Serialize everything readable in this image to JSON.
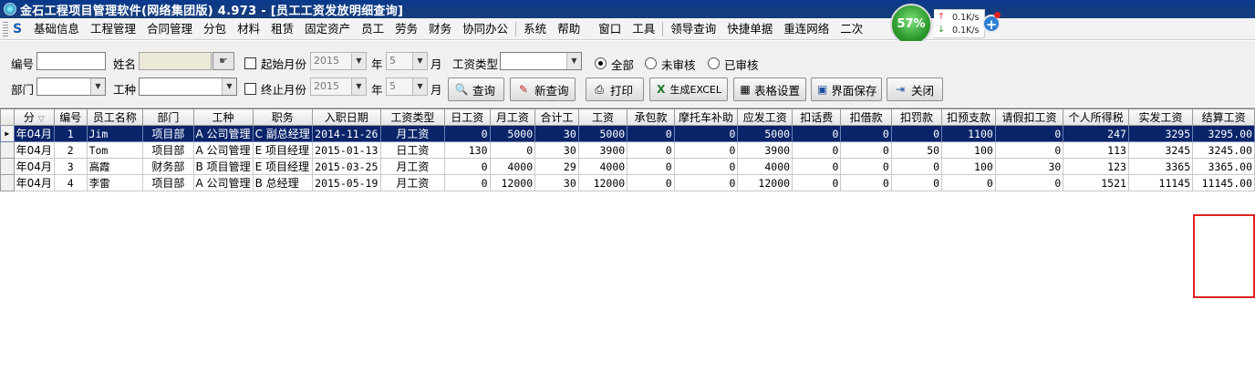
{
  "window": {
    "title": "金石工程项目管理软件(网络集团版) 4.973 - [员工工资发放明细查询]"
  },
  "menu": {
    "items": [
      "基础信息",
      "工程管理",
      "合同管理",
      "分包",
      "材料",
      "租赁",
      "固定资产",
      "员工",
      "劳务",
      "财务",
      "协同办公",
      "系统",
      "帮助",
      "窗口",
      "工具",
      "领导查询",
      "快捷单据",
      "重连网络",
      "二次"
    ]
  },
  "net_widget": {
    "percent": "57%",
    "up": "0.1K/s",
    "down": "0.1K/s",
    "up_arrow": "↑",
    "down_arrow": "↓",
    "plus": "+"
  },
  "filters": {
    "code_label": "编号",
    "code_value": "",
    "name_label": "姓名",
    "name_value": "",
    "start_month_label": "起始月份",
    "start_year": "2015",
    "start_month": "5",
    "year_label": "年",
    "month_label": "月",
    "salary_type_label": "工资类型",
    "salary_type_value": "",
    "radio_all": "全部",
    "radio_unaudited": "未审核",
    "radio_audited": "已审核",
    "dept_label": "部门",
    "dept_value": "",
    "worktype_label": "工种",
    "worktype_value": "",
    "end_month_label": "终止月份",
    "end_year": "2015",
    "end_month": "5"
  },
  "buttons": {
    "query": "查询",
    "new_query": "新查询",
    "print": "打印",
    "export_excel": "生成EXCEL",
    "table_settings": "表格设置",
    "save_layout": "界面保存",
    "close": "关闭"
  },
  "grid": {
    "columns": [
      "分",
      "编号",
      "员工名称",
      "部门",
      "工种",
      "职务",
      "入职日期",
      "工资类型",
      "日工资",
      "月工资",
      "合计工",
      "工资",
      "承包款",
      "摩托车补助",
      "应发工资",
      "扣话费",
      "扣借款",
      "扣罚款",
      "扣预支款",
      "请假扣工资",
      "个人所得税",
      "实发工资",
      "结算工资"
    ],
    "rows": [
      [
        "年04月",
        "1",
        "Jim",
        "项目部",
        "A 公司管理",
        "C 副总经理",
        "2014-11-26",
        "月工资",
        "0",
        "5000",
        "30",
        "5000",
        "0",
        "0",
        "5000",
        "0",
        "0",
        "0",
        "1100",
        "0",
        "247",
        "3295",
        "3295.00"
      ],
      [
        "年04月",
        "2",
        "Tom",
        "项目部",
        "A 公司管理",
        "E 项目经理",
        "2015-01-13",
        "日工资",
        "130",
        "0",
        "30",
        "3900",
        "0",
        "0",
        "3900",
        "0",
        "0",
        "50",
        "100",
        "0",
        "113",
        "3245",
        "3245.00"
      ],
      [
        "年04月",
        "3",
        "高霞",
        "财务部",
        "B 项目管理",
        "E 项目经理",
        "2015-03-25",
        "月工资",
        "0",
        "4000",
        "29",
        "4000",
        "0",
        "0",
        "4000",
        "0",
        "0",
        "0",
        "100",
        "30",
        "123",
        "3365",
        "3365.00"
      ],
      [
        "年04月",
        "4",
        "李雷",
        "项目部",
        "A 公司管理",
        "B 总经理",
        "2015-05-19",
        "月工资",
        "0",
        "12000",
        "30",
        "12000",
        "0",
        "0",
        "12000",
        "0",
        "0",
        "0",
        "0",
        "0",
        "1521",
        "11145",
        "11145.00"
      ]
    ],
    "selected_row": 0
  },
  "icons": {
    "app": "app-logo-icon",
    "menu_logo": "menu-logo-icon",
    "query": "magnifier-icon",
    "new_query": "brush-icon",
    "print": "printer-icon",
    "excel": "excel-icon",
    "table_settings": "table-icon",
    "save": "floppy-icon",
    "close": "exit-door-icon"
  },
  "colors": {
    "highlight_box": "#e02020",
    "selected_row": "#0a246a"
  }
}
